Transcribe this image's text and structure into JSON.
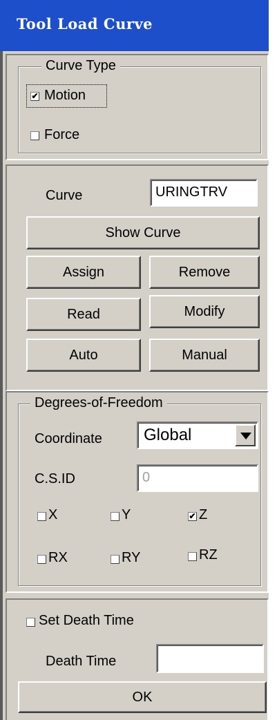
{
  "window": {
    "title": "Tool Load Curve"
  },
  "curve_type": {
    "legend": "Curve Type",
    "motion": {
      "label": "Motion",
      "checked": true
    },
    "force": {
      "label": "Force",
      "checked": false
    }
  },
  "curve": {
    "label": "Curve",
    "value": "URINGTRV",
    "show_curve": "Show Curve",
    "assign": "Assign",
    "remove": "Remove",
    "read": "Read",
    "modify": "Modify",
    "auto": "Auto",
    "manual": "Manual"
  },
  "dof": {
    "legend": "Degrees-of-Freedom",
    "coordinate_label": "Coordinate",
    "coordinate_value": "Global",
    "csid_label": "C.S.ID",
    "csid_value": "0",
    "x": {
      "label": "X",
      "checked": false
    },
    "y": {
      "label": "Y",
      "checked": false
    },
    "z": {
      "label": "Z",
      "checked": true
    },
    "rx": {
      "label": "RX",
      "checked": false
    },
    "ry": {
      "label": "RY",
      "checked": false
    },
    "rz": {
      "label": "RZ",
      "checked": false
    }
  },
  "death": {
    "set_label": "Set Death Time",
    "set_checked": false,
    "time_label": "Death Time",
    "time_value": ""
  },
  "ok": "OK",
  "check_mark": "✔"
}
